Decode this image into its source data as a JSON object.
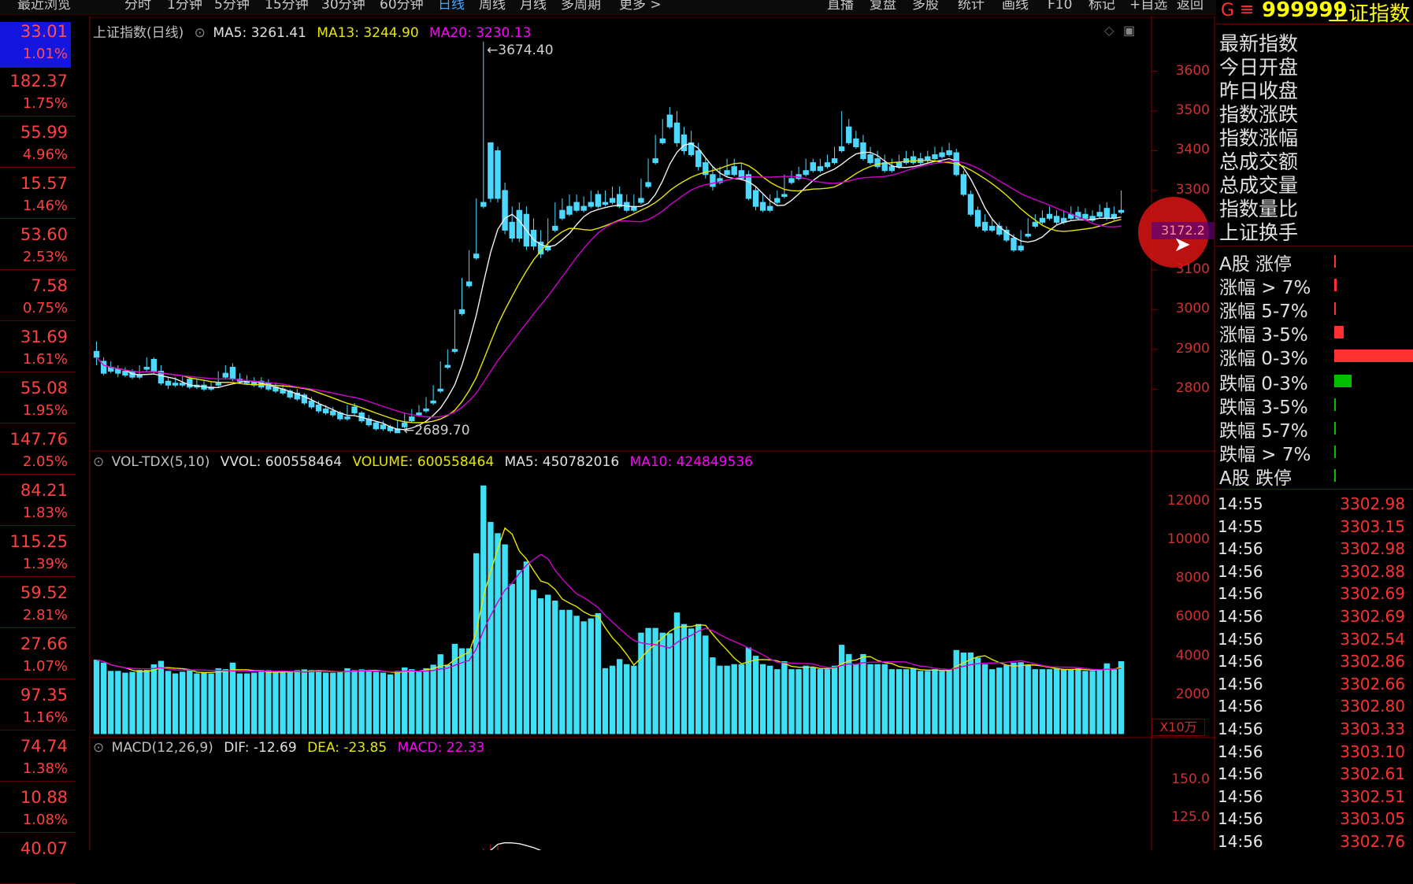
{
  "toolbar": {
    "items": [
      "最近浏览",
      "分时",
      "1分钟",
      "5分钟",
      "15分钟",
      "30分钟",
      "60分钟",
      "日线",
      "周线",
      "月线",
      "多周期",
      "更多 >"
    ],
    "active": "日线",
    "right_items": [
      "直播",
      "复盘",
      "多股",
      "统计",
      "画线",
      "F10",
      "标记",
      "+自选",
      "返回"
    ]
  },
  "left_column": {
    "top": {
      "value": "33.01",
      "pct": "1.01%"
    },
    "rows": [
      {
        "value": "182.37",
        "pct": "1.75%"
      },
      {
        "value": "55.99",
        "pct": "4.96%"
      },
      {
        "value": "15.57",
        "pct": "1.46%"
      },
      {
        "value": "53.60",
        "pct": "2.53%"
      },
      {
        "value": "7.58",
        "pct": "0.75%"
      },
      {
        "value": "31.69",
        "pct": "1.61%"
      },
      {
        "value": "55.08",
        "pct": "1.95%"
      },
      {
        "value": "147.76",
        "pct": "2.05%"
      },
      {
        "value": "84.21",
        "pct": "1.83%"
      },
      {
        "value": "115.25",
        "pct": "1.39%"
      },
      {
        "value": "59.52",
        "pct": "2.81%"
      },
      {
        "value": "27.66",
        "pct": "1.07%"
      },
      {
        "value": "97.35",
        "pct": "1.16%"
      },
      {
        "value": "74.74",
        "pct": "1.38%"
      },
      {
        "value": "10.88",
        "pct": "1.08%"
      },
      {
        "value": "40.07",
        "pct": ""
      }
    ]
  },
  "price_panel": {
    "title": "上证指数(日线)",
    "ma5": "MA5: 3261.41",
    "ma13": "MA13: 3244.90",
    "ma20": "MA20: 3230.13",
    "high_label": "3674.40",
    "low_label": "2689.70",
    "cursor_price": "3172.2",
    "axis": [
      "3600",
      "3500",
      "3400",
      "3300",
      "3100",
      "3000",
      "2900",
      "2800"
    ]
  },
  "volume_panel": {
    "title": "VOL-TDX(5,10)",
    "vvol": "VVOL: 600558464",
    "volume": "VOLUME: 600558464",
    "ma5": "MA5: 450782016",
    "ma10": "MA10: 424849536",
    "axis": [
      "12000",
      "10000",
      "8000",
      "6000",
      "4000",
      "2000"
    ],
    "unit": "X10万"
  },
  "macd_panel": {
    "title": "MACD(12,26,9)",
    "dif": "DIF: -12.69",
    "dea": "DEA: -23.85",
    "macd": "MACD: 22.33",
    "axis": [
      "150.0",
      "125.0"
    ]
  },
  "right_panel": {
    "header": {
      "g": "G",
      "menu": "≡",
      "code": "999999",
      "name": "上证指数"
    },
    "fields": [
      "最新指数",
      "今日开盘",
      "昨日收盘",
      "指数涨跌",
      "指数涨幅",
      "总成交额",
      "总成交量",
      "指数量比",
      "上证换手"
    ],
    "breadth": [
      {
        "label": "A股 涨停",
        "level": 0.02,
        "color": "#ff3030"
      },
      {
        "label": "涨幅 > 7%",
        "level": 0.03,
        "color": "#ff3030"
      },
      {
        "label": "涨幅 5-7%",
        "level": 0.02,
        "color": "#ff3030"
      },
      {
        "label": "涨幅 3-5%",
        "level": 0.12,
        "color": "#ff3030"
      },
      {
        "label": "涨幅 0-3%",
        "level": 1.0,
        "color": "#ff3030"
      },
      {
        "label": "跌幅 0-3%",
        "level": 0.22,
        "color": "#00c000"
      },
      {
        "label": "跌幅 3-5%",
        "level": 0.01,
        "color": "#00c000"
      },
      {
        "label": "跌幅 5-7%",
        "level": 0.01,
        "color": "#00c000"
      },
      {
        "label": "跌幅 > 7%",
        "level": 0.01,
        "color": "#00c000"
      },
      {
        "label": "A股 跌停",
        "level": 0.01,
        "color": "#00c000"
      }
    ],
    "ticks": [
      {
        "time": "14:55",
        "price": "3302.98"
      },
      {
        "time": "14:55",
        "price": "3303.15"
      },
      {
        "time": "14:56",
        "price": "3302.98"
      },
      {
        "time": "14:56",
        "price": "3302.88"
      },
      {
        "time": "14:56",
        "price": "3302.69"
      },
      {
        "time": "14:56",
        "price": "3302.69"
      },
      {
        "time": "14:56",
        "price": "3302.54"
      },
      {
        "time": "14:56",
        "price": "3302.86"
      },
      {
        "time": "14:56",
        "price": "3302.66"
      },
      {
        "time": "14:56",
        "price": "3302.80"
      },
      {
        "time": "14:56",
        "price": "3303.33"
      },
      {
        "time": "14:56",
        "price": "3303.10"
      },
      {
        "time": "14:56",
        "price": "3302.61"
      },
      {
        "time": "14:56",
        "price": "3302.51"
      },
      {
        "time": "14:56",
        "price": "3303.05"
      },
      {
        "time": "14:56",
        "price": "3302.76"
      }
    ]
  },
  "chart_data": {
    "type": "candlestick",
    "title": "上证指数(日线)",
    "ylim": [
      2650,
      3720
    ],
    "candles": [
      [
        2895,
        2920,
        2880,
        2860
      ],
      [
        2870,
        2880,
        2840,
        2835
      ],
      [
        2855,
        2870,
        2845,
        2840
      ],
      [
        2850,
        2860,
        2840,
        2830
      ],
      [
        2845,
        2855,
        2835,
        2830
      ],
      [
        2845,
        2850,
        2830,
        2825
      ],
      [
        2835,
        2860,
        2830,
        2825
      ],
      [
        2855,
        2880,
        2850,
        2845
      ],
      [
        2875,
        2880,
        2845,
        2840
      ],
      [
        2845,
        2860,
        2815,
        2810
      ],
      [
        2820,
        2830,
        2810,
        2800
      ],
      [
        2815,
        2830,
        2810,
        2805
      ],
      [
        2815,
        2835,
        2810,
        2805
      ],
      [
        2825,
        2830,
        2805,
        2800
      ],
      [
        2810,
        2825,
        2805,
        2800
      ],
      [
        2810,
        2820,
        2800,
        2795
      ],
      [
        2805,
        2820,
        2800,
        2795
      ],
      [
        2815,
        2845,
        2810,
        2805
      ],
      [
        2840,
        2860,
        2830,
        2825
      ],
      [
        2855,
        2865,
        2825,
        2820
      ],
      [
        2825,
        2840,
        2820,
        2815
      ],
      [
        2820,
        2835,
        2815,
        2810
      ],
      [
        2820,
        2830,
        2810,
        2805
      ],
      [
        2820,
        2830,
        2805,
        2800
      ],
      [
        2815,
        2825,
        2800,
        2795
      ],
      [
        2805,
        2815,
        2795,
        2790
      ],
      [
        2800,
        2810,
        2790,
        2785
      ],
      [
        2795,
        2800,
        2780,
        2775
      ],
      [
        2790,
        2800,
        2775,
        2770
      ],
      [
        2785,
        2790,
        2765,
        2760
      ],
      [
        2770,
        2780,
        2755,
        2750
      ],
      [
        2760,
        2770,
        2745,
        2740
      ],
      [
        2750,
        2760,
        2740,
        2735
      ],
      [
        2745,
        2755,
        2735,
        2730
      ],
      [
        2740,
        2745,
        2725,
        2720
      ],
      [
        2730,
        2760,
        2725,
        2720
      ],
      [
        2755,
        2765,
        2740,
        2735
      ],
      [
        2740,
        2745,
        2720,
        2715
      ],
      [
        2725,
        2735,
        2710,
        2705
      ],
      [
        2715,
        2720,
        2700,
        2695
      ],
      [
        2710,
        2720,
        2700,
        2695
      ],
      [
        2705,
        2710,
        2695,
        2690
      ],
      [
        2700,
        2720,
        2690,
        2689.7
      ],
      [
        2715,
        2740,
        2705,
        2700
      ],
      [
        2730,
        2750,
        2720,
        2715
      ],
      [
        2740,
        2760,
        2735,
        2730
      ],
      [
        2750,
        2780,
        2745,
        2740
      ],
      [
        2770,
        2810,
        2765,
        2760
      ],
      [
        2800,
        2870,
        2795,
        2790
      ],
      [
        2860,
        2900,
        2855,
        2850
      ],
      [
        2900,
        3000,
        2895,
        2890
      ],
      [
        3000,
        3080,
        2990,
        2985
      ],
      [
        3070,
        3150,
        3060,
        3055
      ],
      [
        3140,
        3280,
        3130,
        3125
      ],
      [
        3270,
        3674.4,
        3260,
        3255
      ],
      [
        3420,
        3420,
        3280,
        3270
      ],
      [
        3400,
        3410,
        3280,
        3270
      ],
      [
        3300,
        3320,
        3200,
        3190
      ],
      [
        3220,
        3260,
        3180,
        3170
      ],
      [
        3250,
        3270,
        3180,
        3170
      ],
      [
        3240,
        3260,
        3160,
        3150
      ],
      [
        3200,
        3230,
        3160,
        3150
      ],
      [
        3170,
        3200,
        3140,
        3130
      ],
      [
        3160,
        3230,
        3150,
        3145
      ],
      [
        3210,
        3270,
        3200,
        3195
      ],
      [
        3250,
        3280,
        3230,
        3225
      ],
      [
        3260,
        3290,
        3240,
        3235
      ],
      [
        3270,
        3290,
        3250,
        3245
      ],
      [
        3260,
        3285,
        3250,
        3245
      ],
      [
        3270,
        3300,
        3260,
        3255
      ],
      [
        3290,
        3300,
        3260,
        3255
      ],
      [
        3270,
        3300,
        3265,
        3260
      ],
      [
        3280,
        3310,
        3270,
        3265
      ],
      [
        3290,
        3310,
        3260,
        3255
      ],
      [
        3270,
        3290,
        3250,
        3245
      ],
      [
        3260,
        3290,
        3250,
        3245
      ],
      [
        3280,
        3330,
        3270,
        3265
      ],
      [
        3320,
        3380,
        3310,
        3305
      ],
      [
        3380,
        3440,
        3370,
        3365
      ],
      [
        3430,
        3480,
        3420,
        3415
      ],
      [
        3490,
        3510,
        3460,
        3455
      ],
      [
        3470,
        3500,
        3420,
        3410
      ],
      [
        3440,
        3460,
        3400,
        3390
      ],
      [
        3420,
        3450,
        3390,
        3385
      ],
      [
        3400,
        3420,
        3360,
        3350
      ],
      [
        3370,
        3380,
        3340,
        3330
      ],
      [
        3340,
        3360,
        3310,
        3300
      ],
      [
        3330,
        3360,
        3320,
        3315
      ],
      [
        3350,
        3380,
        3340,
        3335
      ],
      [
        3360,
        3380,
        3340,
        3335
      ],
      [
        3350,
        3370,
        3330,
        3325
      ],
      [
        3340,
        3350,
        3280,
        3275
      ],
      [
        3300,
        3310,
        3260,
        3250
      ],
      [
        3270,
        3290,
        3250,
        3245
      ],
      [
        3260,
        3290,
        3250,
        3245
      ],
      [
        3280,
        3300,
        3270,
        3265
      ],
      [
        3290,
        3340,
        3285,
        3280
      ],
      [
        3330,
        3350,
        3320,
        3315
      ],
      [
        3340,
        3360,
        3330,
        3325
      ],
      [
        3350,
        3380,
        3340,
        3335
      ],
      [
        3370,
        3380,
        3350,
        3345
      ],
      [
        3360,
        3380,
        3350,
        3345
      ],
      [
        3370,
        3390,
        3360,
        3355
      ],
      [
        3380,
        3410,
        3370,
        3365
      ],
      [
        3410,
        3500,
        3400,
        3395
      ],
      [
        3460,
        3480,
        3420,
        3415
      ],
      [
        3430,
        3450,
        3410,
        3405
      ],
      [
        3420,
        3440,
        3380,
        3375
      ],
      [
        3390,
        3410,
        3370,
        3365
      ],
      [
        3380,
        3400,
        3360,
        3355
      ],
      [
        3370,
        3390,
        3350,
        3345
      ],
      [
        3360,
        3380,
        3350,
        3345
      ],
      [
        3370,
        3390,
        3360,
        3355
      ],
      [
        3380,
        3400,
        3370,
        3365
      ],
      [
        3385,
        3400,
        3370,
        3365
      ],
      [
        3380,
        3395,
        3370,
        3365
      ],
      [
        3385,
        3400,
        3375,
        3370
      ],
      [
        3390,
        3410,
        3380,
        3375
      ],
      [
        3395,
        3410,
        3385,
        3380
      ],
      [
        3400,
        3420,
        3390,
        3385
      ],
      [
        3395,
        3405,
        3340,
        3335
      ],
      [
        3340,
        3350,
        3290,
        3285
      ],
      [
        3290,
        3300,
        3240,
        3235
      ],
      [
        3250,
        3260,
        3210,
        3205
      ],
      [
        3220,
        3240,
        3200,
        3195
      ],
      [
        3210,
        3230,
        3200,
        3195
      ],
      [
        3210,
        3220,
        3190,
        3185
      ],
      [
        3200,
        3210,
        3175,
        3170
      ],
      [
        3180,
        3190,
        3150,
        3145
      ],
      [
        3160,
        3200,
        3150,
        3145
      ],
      [
        3190,
        3230,
        3185,
        3180
      ],
      [
        3220,
        3240,
        3210,
        3205
      ],
      [
        3230,
        3250,
        3220,
        3215
      ],
      [
        3240,
        3260,
        3230,
        3225
      ],
      [
        3235,
        3250,
        3220,
        3215
      ],
      [
        3230,
        3250,
        3220,
        3215
      ],
      [
        3240,
        3260,
        3230,
        3225
      ],
      [
        3245,
        3260,
        3230,
        3225
      ],
      [
        3240,
        3255,
        3230,
        3225
      ],
      [
        3235,
        3250,
        3225,
        3220
      ],
      [
        3245,
        3265,
        3235,
        3230
      ],
      [
        3255,
        3270,
        3230,
        3225
      ],
      [
        3240,
        3260,
        3230,
        3225
      ],
      [
        3250,
        3300,
        3245,
        3240
      ]
    ]
  }
}
